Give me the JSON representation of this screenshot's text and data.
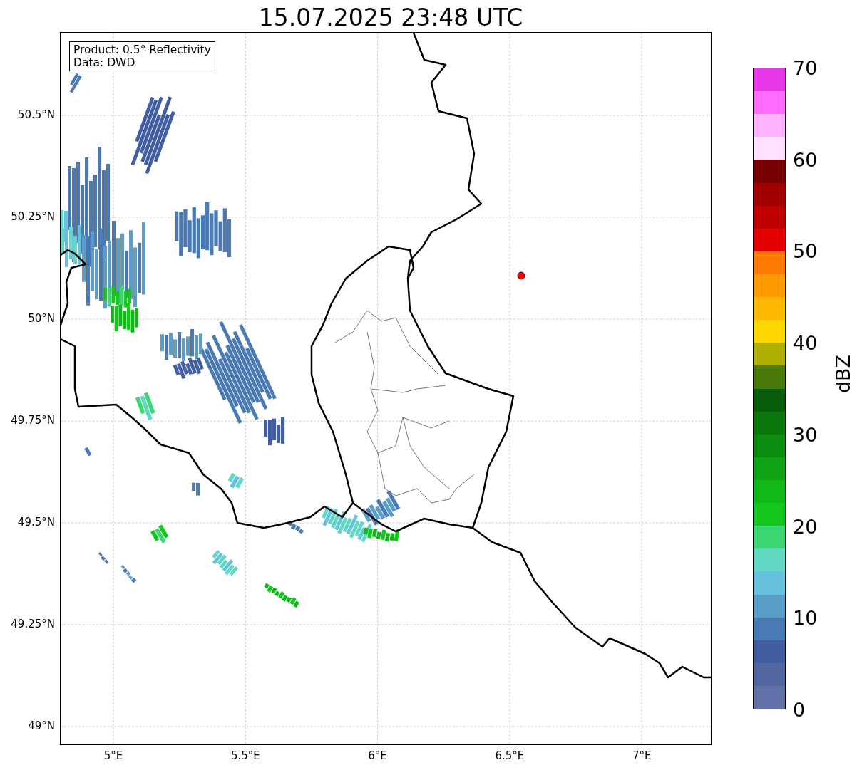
{
  "title": "15.07.2025 23:48 UTC",
  "info_box": [
    "Product: 0.5° Reflectivity",
    "Data: DWD"
  ],
  "x_ticks": [
    "5°E",
    "5.5°E",
    "6°E",
    "6.5°E",
    "7°E"
  ],
  "y_ticks": [
    "50.5°N",
    "50.25°N",
    "50°N",
    "49.75°N",
    "49.5°N",
    "49.25°N",
    "49°N"
  ],
  "colorbar": {
    "label": "dBZ",
    "ticks": [
      "70",
      "60",
      "50",
      "40",
      "30",
      "20",
      "10",
      "0"
    ],
    "bands": [
      {
        "color": "#e838ec"
      },
      {
        "color": "#ff6cff"
      },
      {
        "color": "#ffb2ff"
      },
      {
        "color": "#ffe0ff"
      },
      {
        "color": "#780000"
      },
      {
        "color": "#a00000"
      },
      {
        "color": "#c00000"
      },
      {
        "color": "#e40000"
      },
      {
        "color": "#ff7c00"
      },
      {
        "color": "#ff9a00"
      },
      {
        "color": "#ffb800"
      },
      {
        "color": "#ffd800"
      },
      {
        "color": "#b0b000"
      },
      {
        "color": "#4a7a0a"
      },
      {
        "color": "#085e0a"
      },
      {
        "color": "#0a760c"
      },
      {
        "color": "#0c8c10"
      },
      {
        "color": "#10a414"
      },
      {
        "color": "#10b818"
      },
      {
        "color": "#12c81c"
      },
      {
        "color": "#3cd672"
      },
      {
        "color": "#60d8c4"
      },
      {
        "color": "#66c2dc"
      },
      {
        "color": "#5a9ec8"
      },
      {
        "color": "#4a7ab4"
      },
      {
        "color": "#425ea2"
      },
      {
        "color": "#5266a0"
      },
      {
        "color": "#6272a8"
      }
    ]
  }
}
